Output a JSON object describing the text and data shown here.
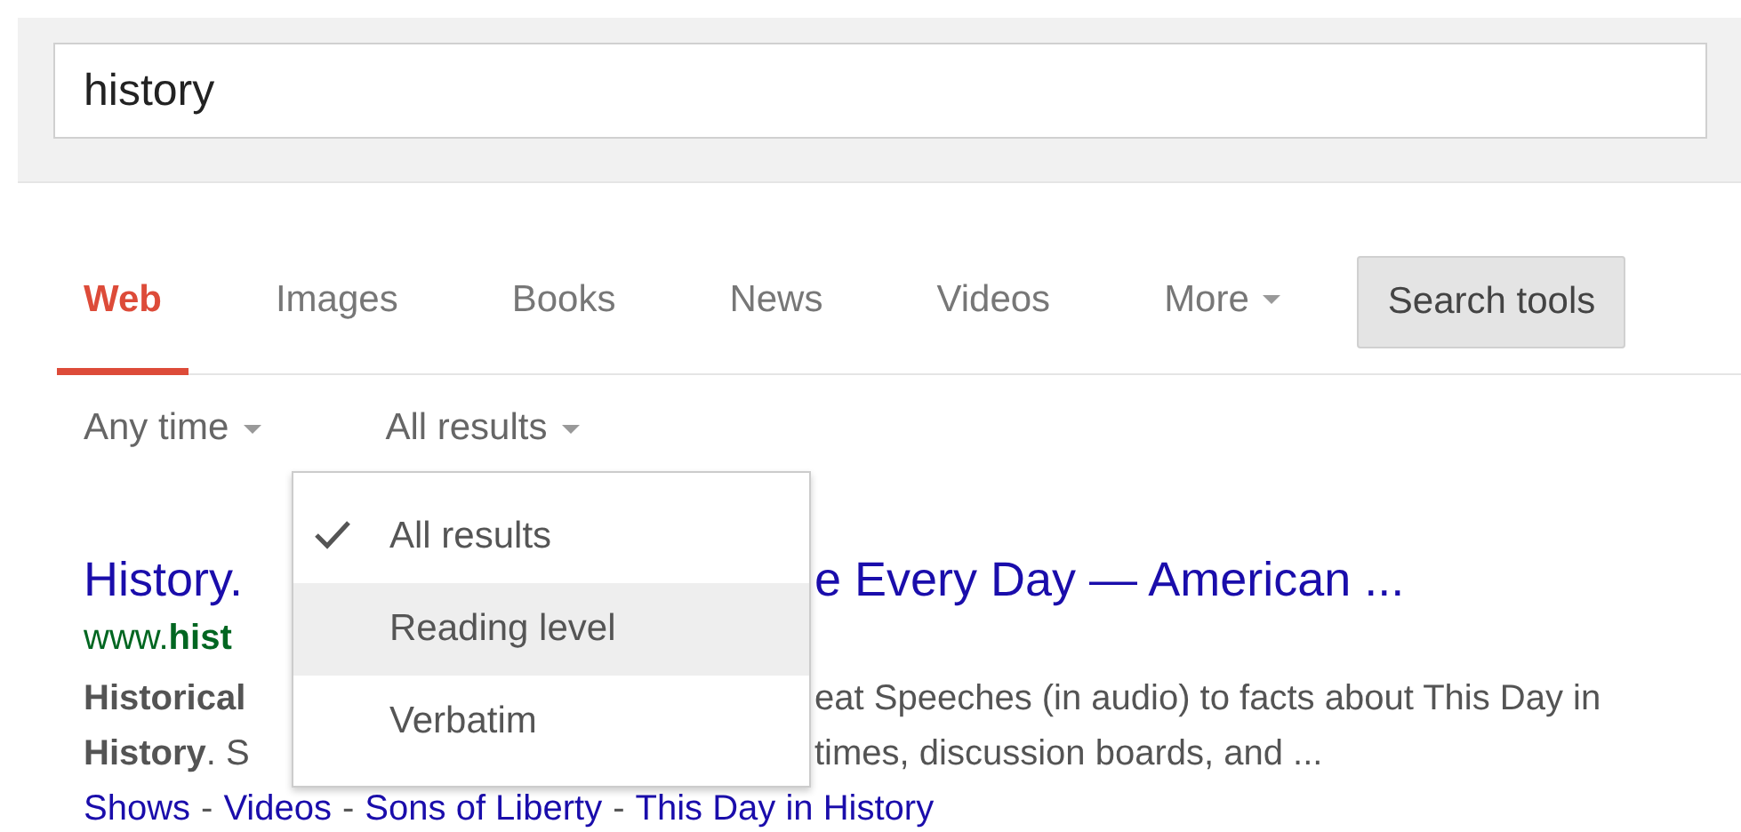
{
  "search": {
    "value": "history"
  },
  "tabs": [
    {
      "label": "Web",
      "selected": true,
      "dropdown": false
    },
    {
      "label": "Images",
      "selected": false,
      "dropdown": false
    },
    {
      "label": "Books",
      "selected": false,
      "dropdown": false
    },
    {
      "label": "News",
      "selected": false,
      "dropdown": false
    },
    {
      "label": "Videos",
      "selected": false,
      "dropdown": false
    },
    {
      "label": "More",
      "selected": false,
      "dropdown": true
    }
  ],
  "search_tools": {
    "label": "Search tools"
  },
  "filters": [
    {
      "label": "Any time"
    },
    {
      "label": "All results"
    }
  ],
  "menu": {
    "items": [
      {
        "label": "All results",
        "checked": true,
        "highlighted": false
      },
      {
        "label": "Reading level",
        "checked": false,
        "highlighted": true
      },
      {
        "label": "Verbatim",
        "checked": false,
        "highlighted": false
      }
    ]
  },
  "result": {
    "title": [
      "History.",
      "e Every Day — American ..."
    ],
    "url": [
      "www.**hist**"
    ],
    "snippet": [
      [
        "**Historical**",
        "eat Speeches (in audio) to facts about This Day in"
      ],
      [
        "**History**. S",
        "times, discussion boards, and ..."
      ]
    ],
    "link_separator": "-",
    "links": [
      "Shows",
      "Videos",
      "Sons of Liberty",
      "This Day in History"
    ]
  }
}
